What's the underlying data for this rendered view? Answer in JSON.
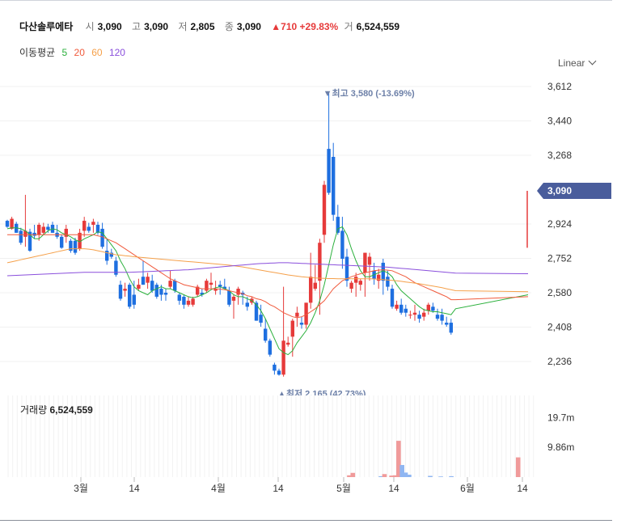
{
  "header": {
    "name": "다산솔루에타",
    "open_label": "시",
    "open": "3,090",
    "high_label": "고",
    "high": "3,090",
    "low_label": "저",
    "low": "2,805",
    "close_label": "종",
    "close": "3,090",
    "change": "▲710 +29.83%",
    "volume_label": "거",
    "volume": "6,524,559"
  },
  "moving_average": {
    "label": "이동평균",
    "periods": [
      {
        "value": "5",
        "color": "#2bb03c"
      },
      {
        "value": "20",
        "color": "#f05a3c"
      },
      {
        "value": "60",
        "color": "#f5a04a"
      },
      {
        "value": "120",
        "color": "#8a4fdc"
      }
    ]
  },
  "scale_selector": "Linear",
  "colors": {
    "up": "#e63a3a",
    "down": "#1e6fe0",
    "price_tag": "#4a5d9c",
    "highlight": "#6d80a8"
  },
  "chart_data": [
    {
      "type": "candlestick",
      "y_axis_ticks": [
        "3,612",
        "3,440",
        "3,268",
        "2,924",
        "2,752",
        "2,580",
        "2,408",
        "2,236"
      ],
      "ylim": [
        2110,
        3640
      ],
      "x_axis_ticks": [
        "3월",
        "14",
        "4월",
        "14",
        "5월",
        "14",
        "6월",
        "14"
      ],
      "current_price_tag": "3,090",
      "high_marker": "▼최고 3,580 (-13.69%)",
      "low_marker": "▲최저 2,165 (42.73%)",
      "candles": [
        [
          2940,
          2945,
          2905,
          2910
        ],
        [
          2900,
          2960,
          2895,
          2950
        ],
        [
          2925,
          2935,
          2880,
          2880
        ],
        [
          2890,
          2905,
          2820,
          2830
        ],
        [
          2860,
          3070,
          2810,
          2890
        ],
        [
          2885,
          2900,
          2785,
          2790
        ],
        [
          2880,
          2920,
          2850,
          2865
        ],
        [
          2870,
          2930,
          2840,
          2920
        ],
        [
          2880,
          2930,
          2870,
          2910
        ],
        [
          2910,
          2925,
          2880,
          2895
        ],
        [
          2920,
          2935,
          2880,
          2880
        ],
        [
          2880,
          2920,
          2850,
          2860
        ],
        [
          2860,
          2870,
          2800,
          2805
        ],
        [
          2860,
          2920,
          2830,
          2900
        ],
        [
          2840,
          2850,
          2780,
          2790
        ],
        [
          2840,
          2855,
          2770,
          2780
        ],
        [
          2800,
          2900,
          2790,
          2880
        ],
        [
          2890,
          2960,
          2860,
          2940
        ],
        [
          2910,
          2930,
          2880,
          2890
        ],
        [
          2920,
          2950,
          2880,
          2935
        ],
        [
          2920,
          2935,
          2870,
          2880
        ],
        [
          2900,
          2930,
          2800,
          2810
        ],
        [
          2790,
          2850,
          2720,
          2740
        ],
        [
          2780,
          2800,
          2750,
          2760
        ],
        [
          2740,
          2760,
          2660,
          2670
        ],
        [
          2620,
          2640,
          2540,
          2550
        ],
        [
          2590,
          2630,
          2560,
          2600
        ],
        [
          2620,
          2630,
          2500,
          2510
        ],
        [
          2570,
          2640,
          2500,
          2520
        ],
        [
          2600,
          2650,
          2590,
          2620
        ],
        [
          2660,
          2740,
          2620,
          2620
        ],
        [
          2630,
          2680,
          2600,
          2660
        ],
        [
          2640,
          2670,
          2580,
          2590
        ],
        [
          2620,
          2630,
          2550,
          2560
        ],
        [
          2600,
          2620,
          2540,
          2570
        ],
        [
          2580,
          2600,
          2540,
          2570
        ],
        [
          2610,
          2690,
          2600,
          2640
        ],
        [
          2640,
          2650,
          2580,
          2590
        ],
        [
          2570,
          2580,
          2520,
          2540
        ],
        [
          2560,
          2570,
          2500,
          2520
        ],
        [
          2520,
          2560,
          2510,
          2540
        ],
        [
          2520,
          2560,
          2510,
          2550
        ],
        [
          2570,
          2620,
          2560,
          2610
        ],
        [
          2580,
          2600,
          2560,
          2570
        ],
        [
          2590,
          2650,
          2580,
          2640
        ],
        [
          2620,
          2680,
          2600,
          2630
        ],
        [
          2590,
          2640,
          2570,
          2600
        ],
        [
          2620,
          2640,
          2570,
          2610
        ],
        [
          2610,
          2650,
          2600,
          2600
        ],
        [
          2590,
          2610,
          2510,
          2520
        ],
        [
          2540,
          2570,
          2450,
          2560
        ],
        [
          2570,
          2610,
          2520,
          2600
        ],
        [
          2580,
          2590,
          2520,
          2570
        ],
        [
          2530,
          2560,
          2490,
          2510
        ],
        [
          2530,
          2560,
          2520,
          2550
        ],
        [
          2530,
          2540,
          2440,
          2440
        ],
        [
          2470,
          2520,
          2410,
          2430
        ],
        [
          2400,
          2450,
          2330,
          2340
        ],
        [
          2340,
          2350,
          2260,
          2270
        ],
        [
          2220,
          2230,
          2170,
          2190
        ],
        [
          2190,
          2200,
          2165,
          2170
        ],
        [
          2170,
          2610,
          2160,
          2340
        ],
        [
          2320,
          2360,
          2310,
          2330
        ],
        [
          2360,
          2450,
          2260,
          2440
        ],
        [
          2460,
          2510,
          2410,
          2480
        ],
        [
          2430,
          2460,
          2400,
          2420
        ],
        [
          2420,
          2530,
          2400,
          2530
        ],
        [
          2530,
          2780,
          2500,
          2660
        ],
        [
          2600,
          2720,
          2590,
          2630
        ],
        [
          2640,
          2850,
          2470,
          2830
        ],
        [
          2870,
          3140,
          2830,
          3120
        ],
        [
          3300,
          3580,
          3070,
          3080
        ],
        [
          3260,
          3330,
          2940,
          2970
        ],
        [
          2960,
          3020,
          2870,
          2880
        ],
        [
          2890,
          2960,
          2700,
          2750
        ],
        [
          2760,
          2800,
          2610,
          2640
        ],
        [
          2600,
          2640,
          2580,
          2630
        ],
        [
          2630,
          2680,
          2560,
          2660
        ],
        [
          2620,
          2650,
          2590,
          2640
        ],
        [
          2680,
          2780,
          2560,
          2780
        ],
        [
          2720,
          2780,
          2640,
          2760
        ],
        [
          2690,
          2730,
          2620,
          2650
        ],
        [
          2640,
          2700,
          2600,
          2670
        ],
        [
          2730,
          2750,
          2570,
          2640
        ],
        [
          2660,
          2690,
          2590,
          2610
        ],
        [
          2600,
          2620,
          2500,
          2510
        ],
        [
          2500,
          2540,
          2490,
          2520
        ],
        [
          2520,
          2550,
          2470,
          2480
        ],
        [
          2500,
          2520,
          2460,
          2480
        ],
        [
          2470,
          2490,
          2450,
          2470
        ],
        [
          2470,
          2520,
          2440,
          2480
        ],
        [
          2470,
          2490,
          2430,
          2450
        ],
        [
          2460,
          2500,
          2440,
          2480
        ],
        [
          2490,
          2530,
          2470,
          2520
        ],
        [
          2510,
          2530,
          2480,
          2490
        ],
        [
          2470,
          2500,
          2440,
          2450
        ],
        [
          2470,
          2500,
          2420,
          2440
        ],
        [
          2430,
          2460,
          2410,
          2420
        ],
        [
          2430,
          2450,
          2370,
          2380
        ],
        [
          2810,
          3090,
          2805,
          3090
        ]
      ],
      "ma5": [
        2900,
        2905,
        2905,
        2900,
        2890,
        2870,
        2850,
        2850,
        2870,
        2890,
        2900,
        2895,
        2880,
        2870,
        2860,
        2845,
        2835,
        2850,
        2860,
        2870,
        2885,
        2880,
        2850,
        2820,
        2790,
        2740,
        2700,
        2650,
        2610,
        2590,
        2580,
        2570,
        2590,
        2600,
        2610,
        2600,
        2600,
        2590,
        2580,
        2570,
        2560,
        2555,
        2560,
        2570,
        2580,
        2595,
        2605,
        2610,
        2600,
        2590,
        2570,
        2560,
        2560,
        2550,
        2540,
        2520,
        2490,
        2450,
        2400,
        2350,
        2300,
        2280,
        2270,
        2290,
        2330,
        2360,
        2390,
        2430,
        2480,
        2540,
        2620,
        2720,
        2820,
        2900,
        2910,
        2870,
        2800,
        2740,
        2690,
        2660,
        2660,
        2670,
        2680,
        2690,
        2680,
        2660,
        2620,
        2590,
        2570,
        2550,
        2530,
        2510,
        2495,
        2490,
        2485,
        2485,
        2480,
        2475,
        2470,
        2500,
        2570
      ],
      "ma20": [
        2870,
        2870,
        2870,
        2870,
        2870,
        2870,
        2870,
        2870,
        2870,
        2870,
        2870,
        2870,
        2870,
        2870,
        2870,
        2870,
        2870,
        2870,
        2870,
        2870,
        2865,
        2860,
        2850,
        2840,
        2830,
        2815,
        2800,
        2785,
        2770,
        2755,
        2740,
        2725,
        2710,
        2695,
        2680,
        2665,
        2650,
        2640,
        2630,
        2620,
        2615,
        2610,
        2605,
        2600,
        2600,
        2600,
        2600,
        2598,
        2595,
        2590,
        2585,
        2580,
        2575,
        2565,
        2560,
        2550,
        2545,
        2535,
        2520,
        2510,
        2495,
        2480,
        2470,
        2460,
        2455,
        2460,
        2470,
        2485,
        2500,
        2520,
        2540,
        2570,
        2600,
        2620,
        2640,
        2650,
        2660,
        2668,
        2675,
        2680,
        2685,
        2690,
        2693,
        2695,
        2693,
        2690,
        2680,
        2670,
        2660,
        2645,
        2630,
        2620,
        2610,
        2600,
        2590,
        2580,
        2570,
        2560,
        2545,
        2545,
        2560
      ],
      "ma60": [
        2730,
        2735,
        2740,
        2745,
        2750,
        2755,
        2760,
        2765,
        2770,
        2775,
        2780,
        2785,
        2790,
        2795,
        2800,
        2800,
        2800,
        2800,
        2798,
        2795,
        2790,
        2785,
        2780,
        2775,
        2770,
        2768,
        2765,
        2763,
        2760,
        2758,
        2756,
        2754,
        2752,
        2750,
        2748,
        2746,
        2744,
        2742,
        2740,
        2738,
        2736,
        2734,
        2732,
        2730,
        2728,
        2726,
        2724,
        2722,
        2720,
        2718,
        2715,
        2712,
        2709,
        2705,
        2701,
        2697,
        2693,
        2689,
        2685,
        2681,
        2677,
        2673,
        2669,
        2666,
        2663,
        2660,
        2658,
        2656,
        2654,
        2653,
        2652,
        2651,
        2651,
        2650,
        2650,
        2650,
        2650,
        2650,
        2650,
        2650,
        2650,
        2649,
        2648,
        2646,
        2644,
        2642,
        2640,
        2637,
        2634,
        2631,
        2628,
        2625,
        2621,
        2617,
        2613,
        2609,
        2605,
        2600,
        2595,
        2590,
        2585
      ],
      "ma120": [
        2665,
        2666,
        2667,
        2668,
        2669,
        2670,
        2671,
        2672,
        2673,
        2674,
        2675,
        2676,
        2677,
        2678,
        2679,
        2680,
        2681,
        2682,
        2682,
        2682,
        2682,
        2682,
        2682,
        2682,
        2682,
        2682,
        2682,
        2682,
        2683,
        2684,
        2685,
        2686,
        2687,
        2688,
        2689,
        2690,
        2691,
        2692,
        2693,
        2694,
        2695,
        2697,
        2699,
        2701,
        2703,
        2705,
        2707,
        2709,
        2711,
        2713,
        2715,
        2717,
        2719,
        2721,
        2723,
        2725,
        2726,
        2727,
        2728,
        2729,
        2730,
        2730,
        2730,
        2729,
        2728,
        2727,
        2726,
        2725,
        2724,
        2723,
        2722,
        2721,
        2720,
        2719,
        2718,
        2717,
        2716,
        2715,
        2714,
        2713,
        2712,
        2711,
        2710,
        2709,
        2708,
        2706,
        2704,
        2702,
        2700,
        2698,
        2696,
        2694,
        2692,
        2690,
        2688,
        2686,
        2684,
        2682,
        2680,
        2678,
        2675
      ]
    },
    {
      "type": "bar",
      "title_label": "거래량",
      "title_value": "6,524,559",
      "y_axis_ticks": [
        "19.7m",
        "9.86m"
      ],
      "ylim": [
        0,
        27000000
      ],
      "volumes": [
        [
          97,
          600000,
          "up"
        ],
        [
          98,
          1400000,
          "up"
        ],
        [
          106,
          300000,
          "down"
        ],
        [
          107,
          1000000,
          "up"
        ],
        [
          109,
          500000,
          "up"
        ],
        [
          110,
          600000,
          "up"
        ],
        [
          111,
          12000000,
          "up"
        ],
        [
          112,
          4000000,
          "down"
        ],
        [
          113,
          1500000,
          "down"
        ],
        [
          114,
          800000,
          "down"
        ],
        [
          120,
          400000,
          "down"
        ],
        [
          123,
          200000,
          "down"
        ],
        [
          126,
          300000,
          "down"
        ],
        [
          145,
          6524559,
          "up"
        ]
      ]
    }
  ]
}
